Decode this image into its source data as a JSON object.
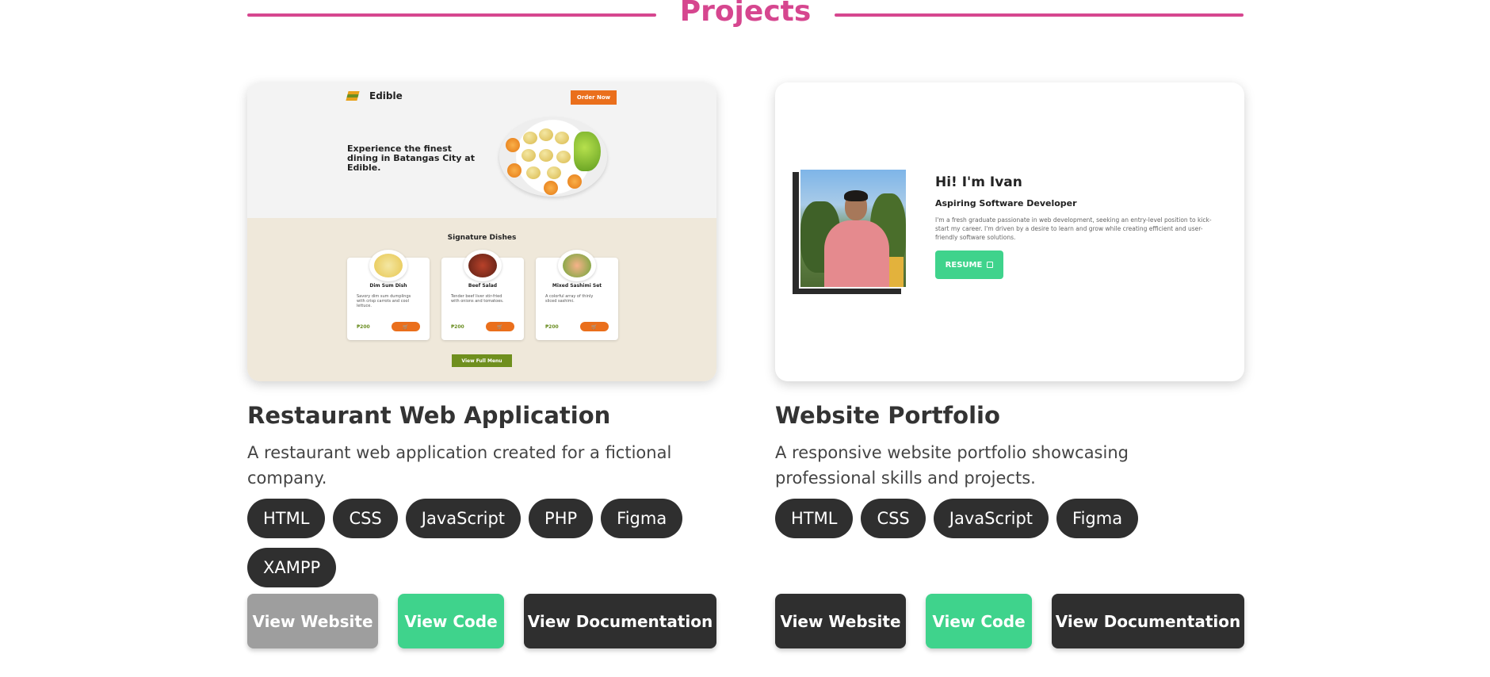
{
  "section": {
    "title": "Projects"
  },
  "projects": [
    {
      "title": "Restaurant Web Application",
      "description": "A restaurant web application created for a fictional company.",
      "tags": [
        "HTML",
        "CSS",
        "JavaScript",
        "PHP",
        "Figma",
        "XAMPP"
      ],
      "buttons": {
        "website": "View Website",
        "code": "View Code",
        "docs": "View Documentation"
      },
      "preview": {
        "brand": "Edible",
        "order_button": "Order Now",
        "hero_text": "Experience the finest dining in Batangas City at Edible.",
        "signature_title": "Signature Dishes",
        "dishes": [
          {
            "name": "Dim Sum Dish",
            "desc": "Savory dim sum dumplings with crisp carrots and cool lettuce.",
            "price": "₱200",
            "color": "#e7c64f"
          },
          {
            "name": "Beef Salad",
            "desc": "Tender beef liver stir-fried with onions and tomatoes.",
            "price": "₱200",
            "color": "#7a2f1e"
          },
          {
            "name": "Mixed Sashimi Set",
            "desc": "A colorful array of thinly sliced sashimi.",
            "price": "₱200",
            "color": "#f08a5d"
          }
        ],
        "menu_button": "View Full Menu"
      }
    },
    {
      "title": "Website Portfolio",
      "description": "A responsive website portfolio showcasing professional skills and projects.",
      "tags": [
        "HTML",
        "CSS",
        "JavaScript",
        "Figma"
      ],
      "buttons": {
        "website": "View Website",
        "code": "View Code",
        "docs": "View Documentation"
      },
      "preview": {
        "greeting": "Hi! I'm Ivan",
        "role": "Aspiring Software Developer",
        "bio": "I'm a fresh graduate passionate in web development, seeking an entry-level position to kick-start my career. I'm driven by a desire to learn and grow while creating efficient and user-friendly software solutions.",
        "resume_button": "RESUME"
      }
    }
  ],
  "colors": {
    "accent": "#d6468f",
    "green": "#3fd38c",
    "dark": "#2f2f2f",
    "disabled": "#9e9e9e"
  }
}
